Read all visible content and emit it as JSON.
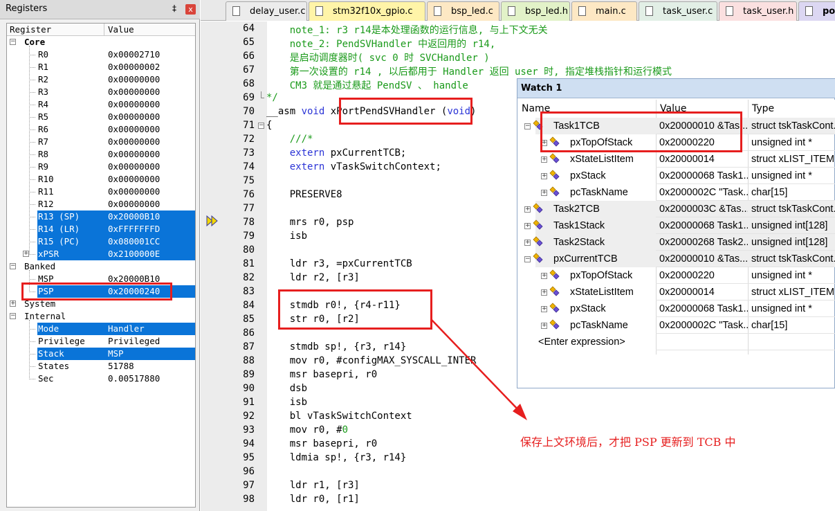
{
  "registers_panel": {
    "title": "Registers",
    "pin_glyph": "‡",
    "close_glyph": "x",
    "col_register": "Register",
    "col_value": "Value",
    "rows": [
      {
        "name": "Core",
        "value": "",
        "level": 0,
        "box": "−",
        "bold": true,
        "sel": false
      },
      {
        "name": "R0",
        "value": "0x00002710",
        "level": 1,
        "sel": false
      },
      {
        "name": "R1",
        "value": "0x00000002",
        "level": 1,
        "sel": false
      },
      {
        "name": "R2",
        "value": "0x00000000",
        "level": 1,
        "sel": false
      },
      {
        "name": "R3",
        "value": "0x00000000",
        "level": 1,
        "sel": false
      },
      {
        "name": "R4",
        "value": "0x00000000",
        "level": 1,
        "sel": false
      },
      {
        "name": "R5",
        "value": "0x00000000",
        "level": 1,
        "sel": false
      },
      {
        "name": "R6",
        "value": "0x00000000",
        "level": 1,
        "sel": false
      },
      {
        "name": "R7",
        "value": "0x00000000",
        "level": 1,
        "sel": false
      },
      {
        "name": "R8",
        "value": "0x00000000",
        "level": 1,
        "sel": false
      },
      {
        "name": "R9",
        "value": "0x00000000",
        "level": 1,
        "sel": false
      },
      {
        "name": "R10",
        "value": "0x00000000",
        "level": 1,
        "sel": false
      },
      {
        "name": "R11",
        "value": "0x00000000",
        "level": 1,
        "sel": false
      },
      {
        "name": "R12",
        "value": "0x00000000",
        "level": 1,
        "sel": false
      },
      {
        "name": "R13 (SP)",
        "value": "0x20000B10",
        "level": 1,
        "sel": true
      },
      {
        "name": "R14 (LR)",
        "value": "0xFFFFFFFD",
        "level": 1,
        "sel": true
      },
      {
        "name": "R15 (PC)",
        "value": "0x080001CC",
        "level": 1,
        "sel": true
      },
      {
        "name": "xPSR",
        "value": "0x2100000E",
        "level": 1,
        "box": "+",
        "sel": true
      },
      {
        "name": "Banked",
        "value": "",
        "level": 0,
        "box": "−",
        "sel": false
      },
      {
        "name": "MSP",
        "value": "0x20000B10",
        "level": 1,
        "sel": false
      },
      {
        "name": "PSP",
        "value": "0x20000240",
        "level": 1,
        "sel": true
      },
      {
        "name": "System",
        "value": "",
        "level": 0,
        "box": "+",
        "sel": false
      },
      {
        "name": "Internal",
        "value": "",
        "level": 0,
        "box": "−",
        "sel": false
      },
      {
        "name": "Mode",
        "value": "Handler",
        "level": 1,
        "sel": true
      },
      {
        "name": "Privilege",
        "value": "Privileged",
        "level": 1,
        "sel": false
      },
      {
        "name": "Stack",
        "value": "MSP",
        "level": 1,
        "sel": true
      },
      {
        "name": "States",
        "value": "51788",
        "level": 1,
        "sel": false
      },
      {
        "name": "Sec",
        "value": "0.00517880",
        "level": 1,
        "sel": false
      }
    ]
  },
  "tabs": [
    {
      "label": "delay_user.c",
      "color": "#ececec",
      "icon": "#ffffff"
    },
    {
      "label": "stm32f10x_gpio.c",
      "color": "#fff4a8",
      "icon": "#ffffff"
    },
    {
      "label": "bsp_led.c",
      "color": "#fde8c4",
      "icon": "#ffffff"
    },
    {
      "label": "bsp_led.h",
      "color": "#e2f2c8",
      "icon": "#ffffff"
    },
    {
      "label": "main.c",
      "color": "#fde8c4",
      "icon": "#ffffff"
    },
    {
      "label": "task_user.c",
      "color": "#e2efe6",
      "icon": "#ffffff"
    },
    {
      "label": "task_user.h",
      "color": "#fbe0e0",
      "icon": "#ffffff"
    },
    {
      "label": "po",
      "color": "#dcd7f2",
      "icon": "#ffffff"
    }
  ],
  "code_lines": [
    {
      "num": "64",
      "segs": [
        {
          "t": "    note_1: r3 r14是本处理函数的运行信息, 与上下文无关",
          "c": "cm"
        }
      ]
    },
    {
      "num": "65",
      "segs": [
        {
          "t": "    note_2: PendSVHandler 中返回用的 r14,",
          "c": "cm"
        }
      ]
    },
    {
      "num": "66",
      "segs": [
        {
          "t": "    是启动调度器时( svc 0 时 SVCHandler )",
          "c": "cm"
        }
      ]
    },
    {
      "num": "67",
      "segs": [
        {
          "t": "    第一次设置的 r14 , 以后都用于 Handler 返回 user 时, 指定堆栈指针和运行模式",
          "c": "cm"
        }
      ]
    },
    {
      "num": "68",
      "segs": [
        {
          "t": "    CM3 就是通过悬起 PendSV 、 handle",
          "c": "cm"
        }
      ]
    },
    {
      "num": "69",
      "fold": "end",
      "segs": [
        {
          "t": "*/",
          "c": "cm"
        }
      ]
    },
    {
      "num": "70",
      "segs": [
        {
          "t": "__asm ",
          "c": ""
        },
        {
          "t": "void",
          "c": "kw"
        },
        {
          "t": " xPortPendSVHandler (",
          "c": ""
        },
        {
          "t": "void",
          "c": "kw"
        },
        {
          "t": ")",
          "c": ""
        }
      ]
    },
    {
      "num": "71",
      "fold": "box",
      "segs": [
        {
          "t": "{",
          "c": ""
        }
      ]
    },
    {
      "num": "72",
      "segs": [
        {
          "t": "    ///*",
          "c": "cm"
        }
      ]
    },
    {
      "num": "73",
      "segs": [
        {
          "t": "    ",
          "c": ""
        },
        {
          "t": "extern",
          "c": "kw"
        },
        {
          "t": " pxCurrentTCB;",
          "c": ""
        }
      ]
    },
    {
      "num": "74",
      "segs": [
        {
          "t": "    ",
          "c": ""
        },
        {
          "t": "extern",
          "c": "kw"
        },
        {
          "t": " vTaskSwitchContext;",
          "c": ""
        }
      ]
    },
    {
      "num": "75",
      "segs": []
    },
    {
      "num": "76",
      "segs": [
        {
          "t": "    PRESERVE8",
          "c": ""
        }
      ]
    },
    {
      "num": "77",
      "segs": []
    },
    {
      "num": "78",
      "segs": [
        {
          "t": "    mrs r0, psp",
          "c": ""
        }
      ]
    },
    {
      "num": "79",
      "segs": [
        {
          "t": "    isb",
          "c": ""
        }
      ]
    },
    {
      "num": "80",
      "segs": []
    },
    {
      "num": "81",
      "segs": [
        {
          "t": "    ldr r3, =pxCurrentTCB",
          "c": ""
        }
      ]
    },
    {
      "num": "82",
      "segs": [
        {
          "t": "    ldr r2, [r3]",
          "c": ""
        }
      ]
    },
    {
      "num": "83",
      "segs": []
    },
    {
      "num": "84",
      "segs": [
        {
          "t": "    stmdb r0!, {r4-r11}",
          "c": ""
        }
      ]
    },
    {
      "num": "85",
      "segs": [
        {
          "t": "    str r0, [r2]",
          "c": ""
        }
      ]
    },
    {
      "num": "86",
      "segs": []
    },
    {
      "num": "87",
      "segs": [
        {
          "t": "    stmdb sp!, {r3, r14}",
          "c": ""
        }
      ]
    },
    {
      "num": "88",
      "segs": [
        {
          "t": "    mov r0, #configMAX_SYSCALL_INTER",
          "c": ""
        }
      ]
    },
    {
      "num": "89",
      "segs": [
        {
          "t": "    msr basepri, r0",
          "c": ""
        }
      ]
    },
    {
      "num": "90",
      "segs": [
        {
          "t": "    dsb",
          "c": ""
        }
      ]
    },
    {
      "num": "91",
      "segs": [
        {
          "t": "    isb",
          "c": ""
        }
      ]
    },
    {
      "num": "92",
      "segs": [
        {
          "t": "    bl vTaskSwitchContext",
          "c": ""
        }
      ]
    },
    {
      "num": "93",
      "segs": [
        {
          "t": "    mov r0, #",
          "c": ""
        },
        {
          "t": "0",
          "c": "cm"
        }
      ]
    },
    {
      "num": "94",
      "segs": [
        {
          "t": "    msr basepri, r0",
          "c": ""
        }
      ]
    },
    {
      "num": "95",
      "segs": [
        {
          "t": "    ldmia sp!, {r3, r14}",
          "c": ""
        }
      ]
    },
    {
      "num": "96",
      "segs": []
    },
    {
      "num": "97",
      "segs": [
        {
          "t": "    ldr r1, [r3]",
          "c": ""
        }
      ]
    },
    {
      "num": "98",
      "segs": [
        {
          "t": "    ldr r0, [r1]",
          "c": ""
        }
      ]
    }
  ],
  "watch": {
    "title": "Watch 1",
    "col_name": "Name",
    "col_value": "Value",
    "col_type": "Type",
    "rows": [
      {
        "name": "Task1TCB",
        "value": "0x20000010 &Tas...",
        "type": "struct tskTaskCont...",
        "level": 0,
        "box": "−"
      },
      {
        "name": "pxTopOfStack",
        "value": "0x20000220",
        "type": "unsigned int *",
        "level": 1,
        "box": "+"
      },
      {
        "name": "xStateListItem",
        "value": "0x20000014",
        "type": "struct xLIST_ITEM",
        "level": 1,
        "box": "+"
      },
      {
        "name": "pxStack",
        "value": "0x20000068 Task1...",
        "type": "unsigned int *",
        "level": 1,
        "box": "+"
      },
      {
        "name": "pcTaskName",
        "value": "0x2000002C \"Task...",
        "type": "char[15]",
        "level": 1,
        "box": "+"
      },
      {
        "name": "Task2TCB",
        "value": "0x2000003C &Tas...",
        "type": "struct tskTaskCont...",
        "level": 0,
        "box": "+"
      },
      {
        "name": "Task1Stack",
        "value": "0x20000068 Task1...",
        "type": "unsigned int[128]",
        "level": 0,
        "box": "+"
      },
      {
        "name": "Task2Stack",
        "value": "0x20000268 Task2...",
        "type": "unsigned int[128]",
        "level": 0,
        "box": "+"
      },
      {
        "name": "pxCurrentTCB",
        "value": "0x20000010 &Tas...",
        "type": "struct tskTaskCont...",
        "level": 0,
        "box": "−"
      },
      {
        "name": "pxTopOfStack",
        "value": "0x20000220",
        "type": "unsigned int *",
        "level": 1,
        "box": "+"
      },
      {
        "name": "xStateListItem",
        "value": "0x20000014",
        "type": "struct xLIST_ITEM",
        "level": 1,
        "box": "+"
      },
      {
        "name": "pxStack",
        "value": "0x20000068 Task1...",
        "type": "unsigned int *",
        "level": 1,
        "box": "+"
      },
      {
        "name": "pcTaskName",
        "value": "0x2000002C \"Task...",
        "type": "char[15]",
        "level": 1,
        "box": "+"
      }
    ],
    "enter_expression": "<Enter expression>"
  },
  "annotation": {
    "note": "保存上文环境后，才把 PSP 更新到 TCB 中",
    "color": "#e61e1e"
  }
}
